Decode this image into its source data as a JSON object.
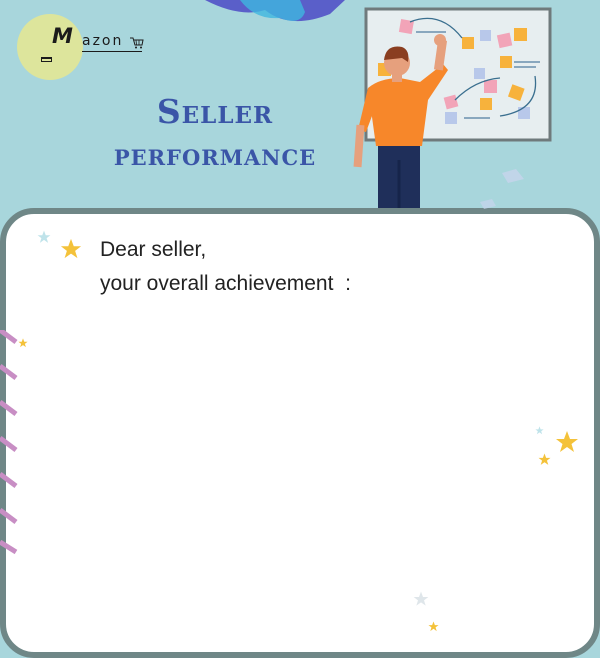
{
  "brand": {
    "initial": "M",
    "name": "azon"
  },
  "header": {
    "title_line1": "Seller",
    "title_line2": "performance"
  },
  "greeting": {
    "line1": "Dear seller,",
    "line2": "your overall achievement  :"
  },
  "colors": {
    "background": "#a8d6dc",
    "card_border": "#6f8787",
    "title": "#3a55a7",
    "logo_circle": "#dde59c"
  }
}
